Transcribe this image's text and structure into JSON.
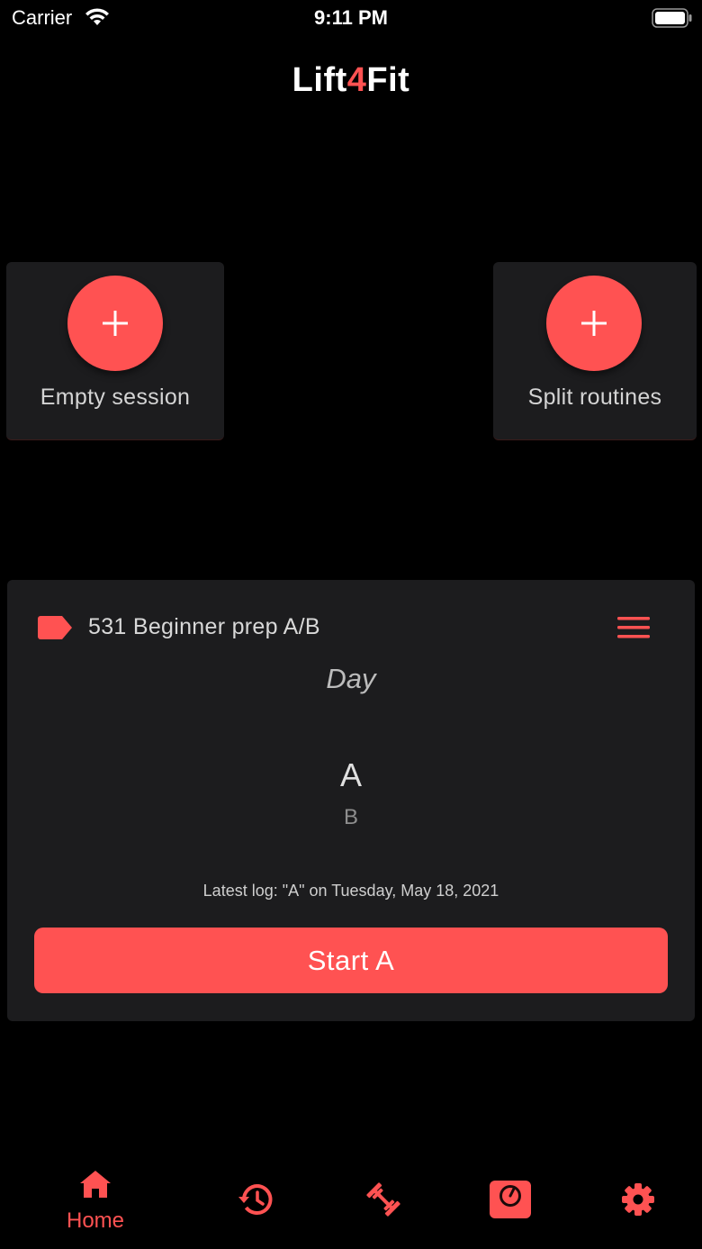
{
  "status_bar": {
    "carrier": "Carrier",
    "time": "9:11 PM"
  },
  "header": {
    "title_prefix": "Lift",
    "title_accent": "4",
    "title_suffix": "Fit"
  },
  "actions": {
    "empty_session_label": "Empty session",
    "split_routines_label": "Split routines"
  },
  "routine": {
    "name": "531 Beginner prep A/B",
    "day_label": "Day",
    "selected_day": "A",
    "next_day": "B",
    "latest_log": "Latest log: \"A\" on Tuesday, May 18, 2021",
    "start_label": "Start A"
  },
  "tab_bar": {
    "items": [
      {
        "label": "Home",
        "icon": "home-icon"
      },
      {
        "label": "",
        "icon": "history-icon"
      },
      {
        "label": "",
        "icon": "dumbbell-icon"
      },
      {
        "label": "",
        "icon": "scale-icon"
      },
      {
        "label": "",
        "icon": "gear-icon"
      }
    ]
  },
  "colors": {
    "accent": "#ff5252",
    "background": "#000000",
    "card": "#1c1c1e"
  }
}
